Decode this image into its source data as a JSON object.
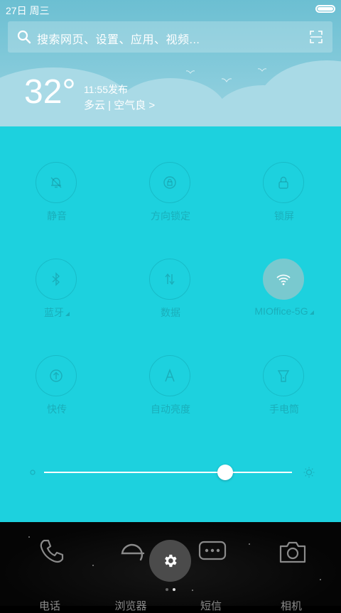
{
  "status_bar": {
    "date": "27日",
    "weekday": "周三",
    "battery_level": 1.0
  },
  "search": {
    "placeholder": "搜索网页、设置、应用、视频...",
    "icon": "search-icon",
    "scan_icon": "scan-icon"
  },
  "weather": {
    "temperature": "32°",
    "release": "11:55发布",
    "condition": "多云 | 空气良 >"
  },
  "toggles": [
    {
      "label": "静音",
      "icon": "bell-icon",
      "active": false
    },
    {
      "label": "方向锁定",
      "icon": "rotation-lock-icon",
      "active": false
    },
    {
      "label": "锁屏",
      "icon": "lock-icon",
      "active": false
    },
    {
      "label": "蓝牙",
      "icon": "bluetooth-icon",
      "active": false
    },
    {
      "label": "数据",
      "icon": "mobile-data-icon",
      "active": false
    },
    {
      "label": "MIOffice-5G",
      "icon": "wifi-icon",
      "active": true
    },
    {
      "label": "快传",
      "icon": "transfer-icon",
      "active": false
    },
    {
      "label": "自动亮度",
      "icon": "auto-brightness-icon",
      "active": false
    },
    {
      "label": "手电筒",
      "icon": "flashlight-icon",
      "active": false
    }
  ],
  "brightness": {
    "level": 0.73
  },
  "dock": {
    "apps": [
      {
        "label": "电话",
        "icon": "phone-icon"
      },
      {
        "label": "浏览器",
        "icon": "browser-icon"
      },
      {
        "label": "短信",
        "icon": "messages-icon"
      },
      {
        "label": "相机",
        "icon": "camera-icon"
      }
    ],
    "page_indicator": {
      "pages": 2,
      "current": 2
    }
  },
  "colors": {
    "panel": "#1dd1de",
    "wifi_active": "#79c9cf",
    "sky": "#7cc6d7"
  }
}
